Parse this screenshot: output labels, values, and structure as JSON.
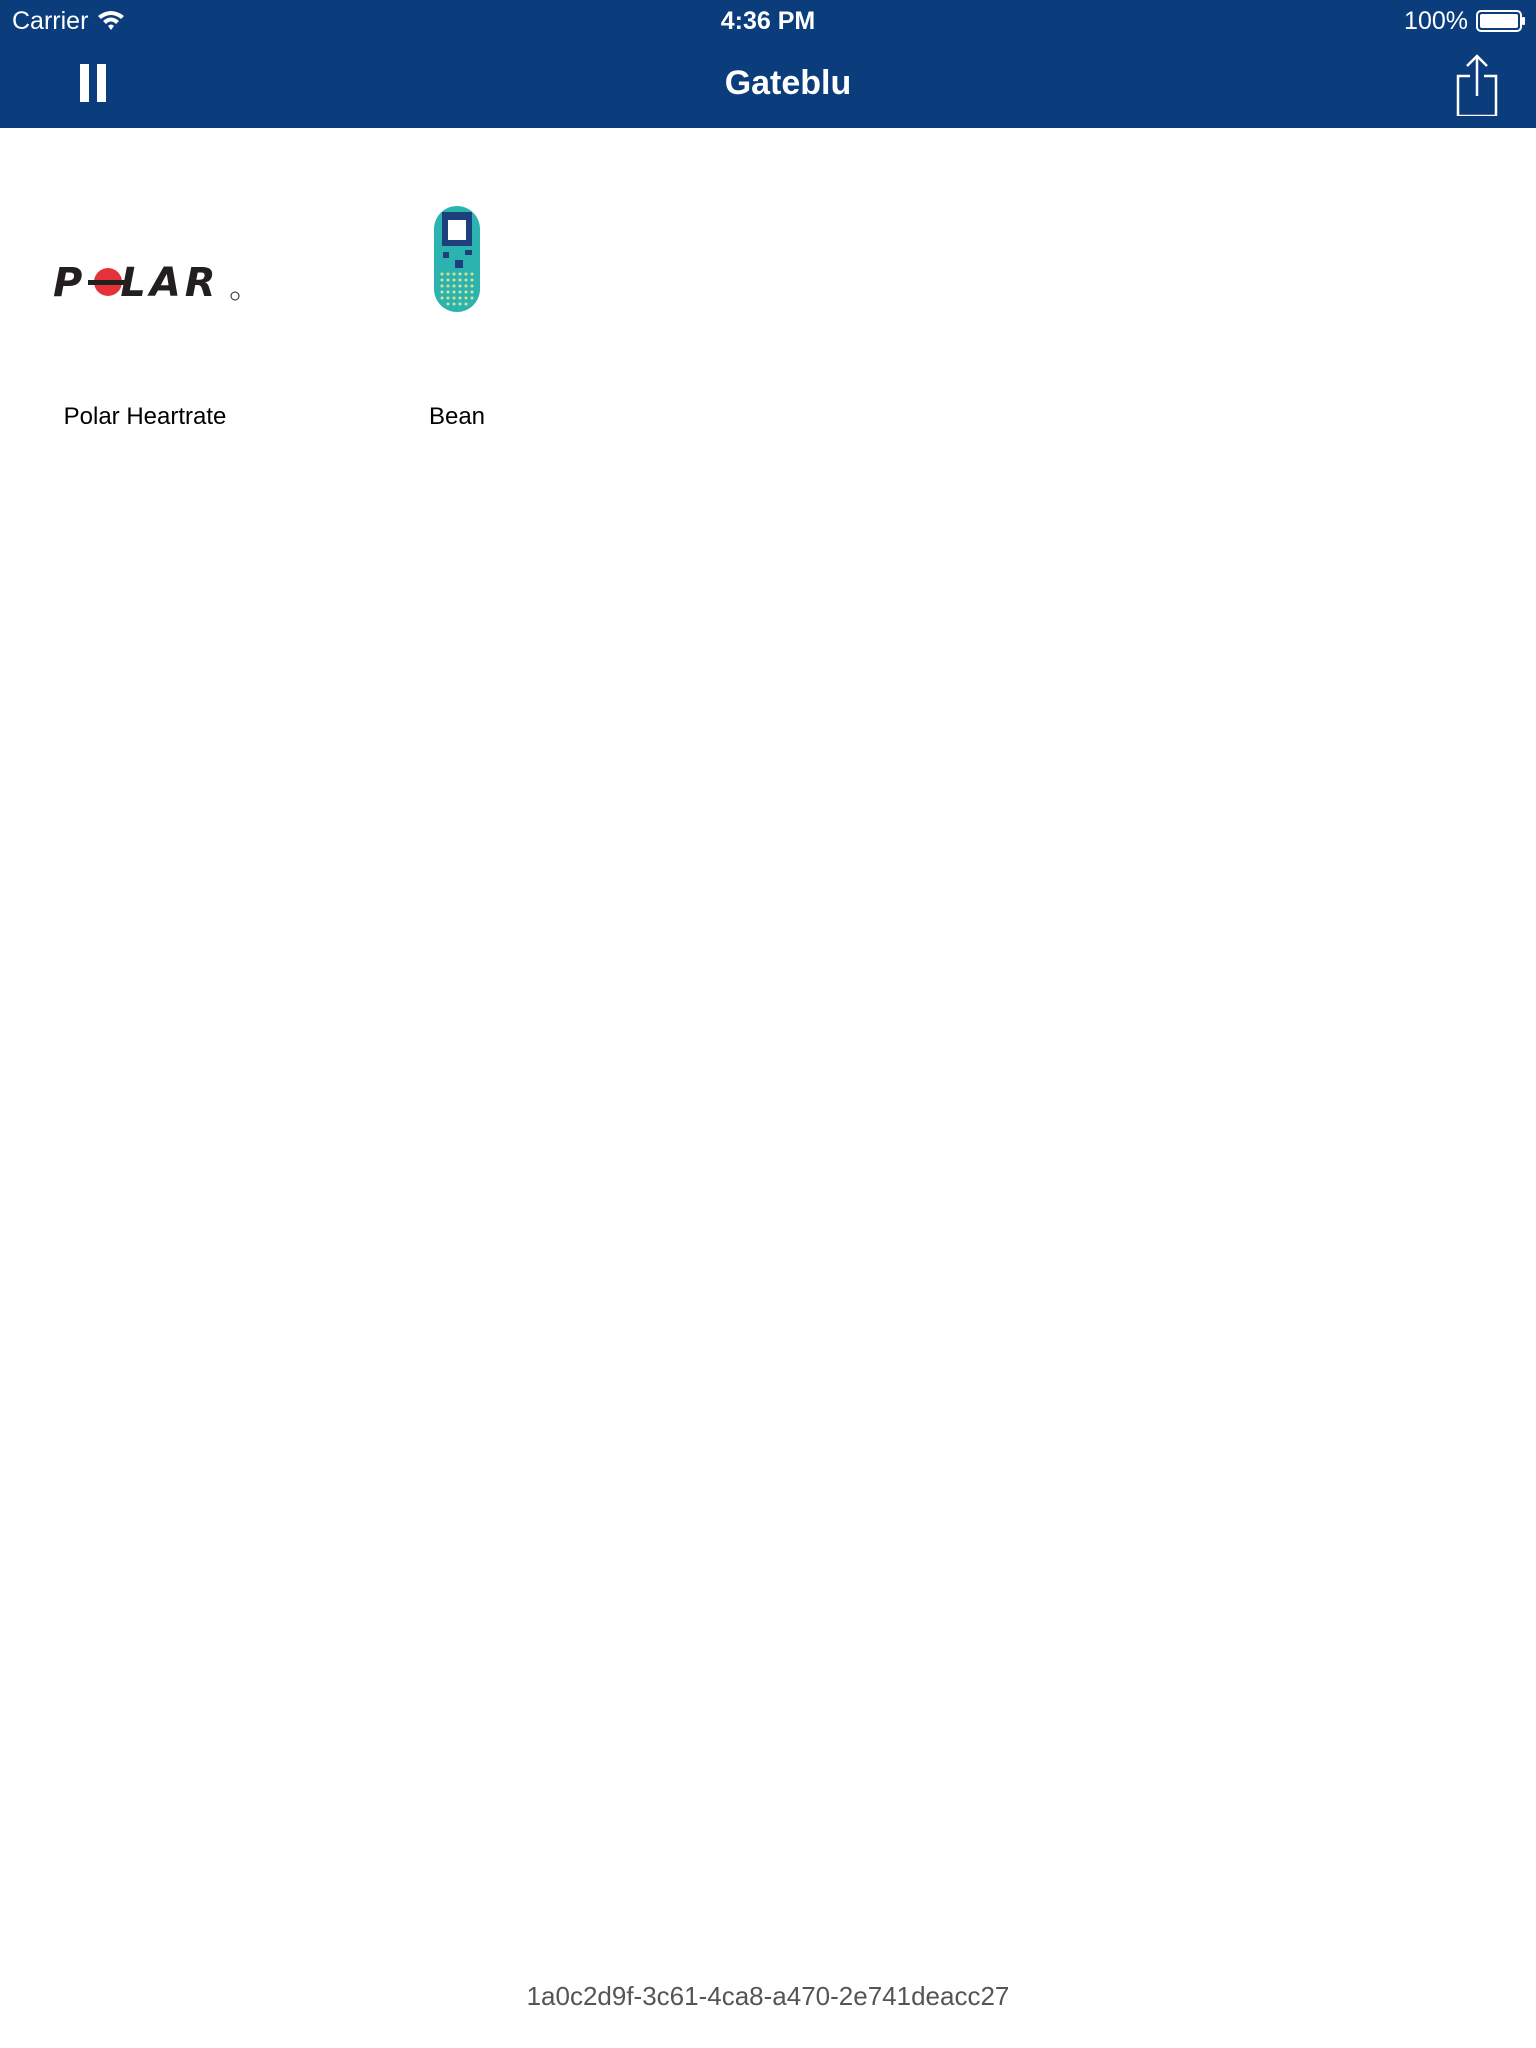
{
  "status_bar": {
    "carrier": "Carrier",
    "time": "4:36 PM",
    "battery": "100%"
  },
  "nav": {
    "title": "Gateblu",
    "left_icon": "pause-icon",
    "right_icon": "share-icon"
  },
  "devices": [
    {
      "label": "Polar Heartrate",
      "logo_text": "POLAR",
      "icon": "polar-logo-icon"
    },
    {
      "label": "Bean",
      "icon": "bean-board-icon"
    }
  ],
  "footer": {
    "device_id": "1a0c2d9f-3c61-4ca8-a470-2e741deacc27"
  },
  "colors": {
    "header_bg": "#0b3c7c",
    "polar_red": "#e53238",
    "bean_teal": "#2bb3b0",
    "bean_dark_blue": "#1d3f7c"
  }
}
